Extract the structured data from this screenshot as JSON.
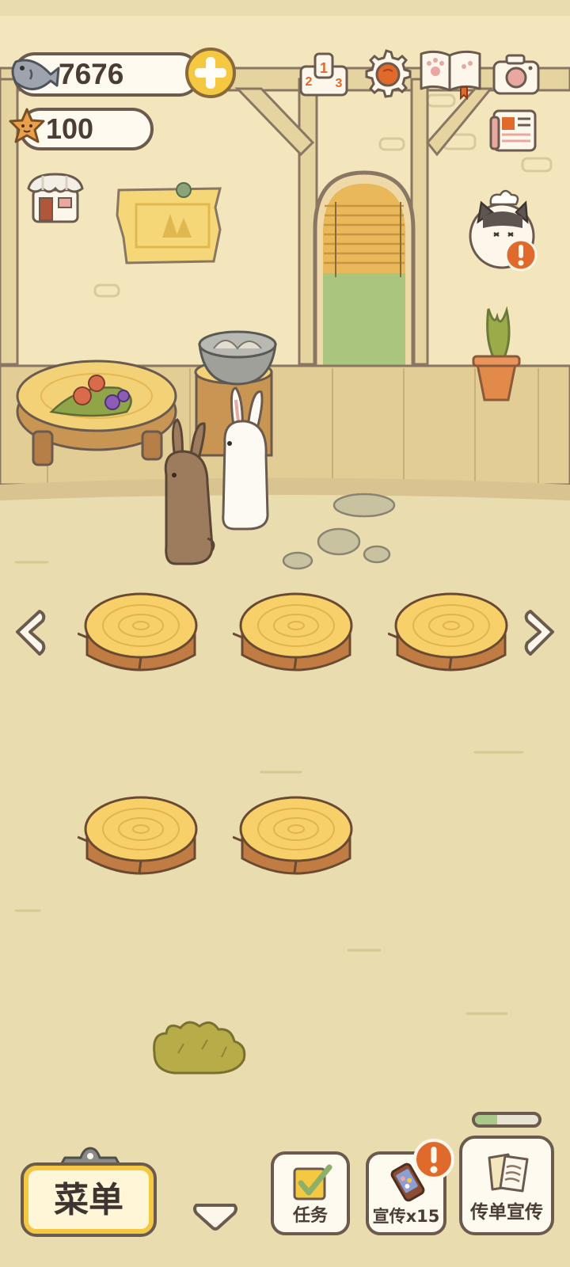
{
  "currency": {
    "fish_value": "7676",
    "star_value": "100",
    "icons": {
      "fish": "fish-icon",
      "star": "star-icon",
      "add": "plus-icon"
    }
  },
  "top_icons": [
    "ranking-podium-icon",
    "gear-icon",
    "paw-book-icon",
    "camera-icon",
    "newspaper-icon",
    "shop-icon"
  ],
  "chef": {
    "icon": "chef-cat-icon",
    "alert_icon": "exclamation-icon"
  },
  "stumps": {
    "icon": "tree-stump-seat",
    "rows": 2,
    "visible": 5
  },
  "bottom_bar": {
    "menu_label": "菜单",
    "tasks_label": "任务",
    "promo_label": "宣传x15",
    "flyer_label": "传单宣传",
    "flyer_progress": 0.35
  },
  "colors": {
    "background": "#e9ddb0",
    "outline": "#6b5a4e",
    "accent_yellow": "#f5c842",
    "alert_orange": "#e06a2b",
    "progress_green": "#a8c98a"
  }
}
